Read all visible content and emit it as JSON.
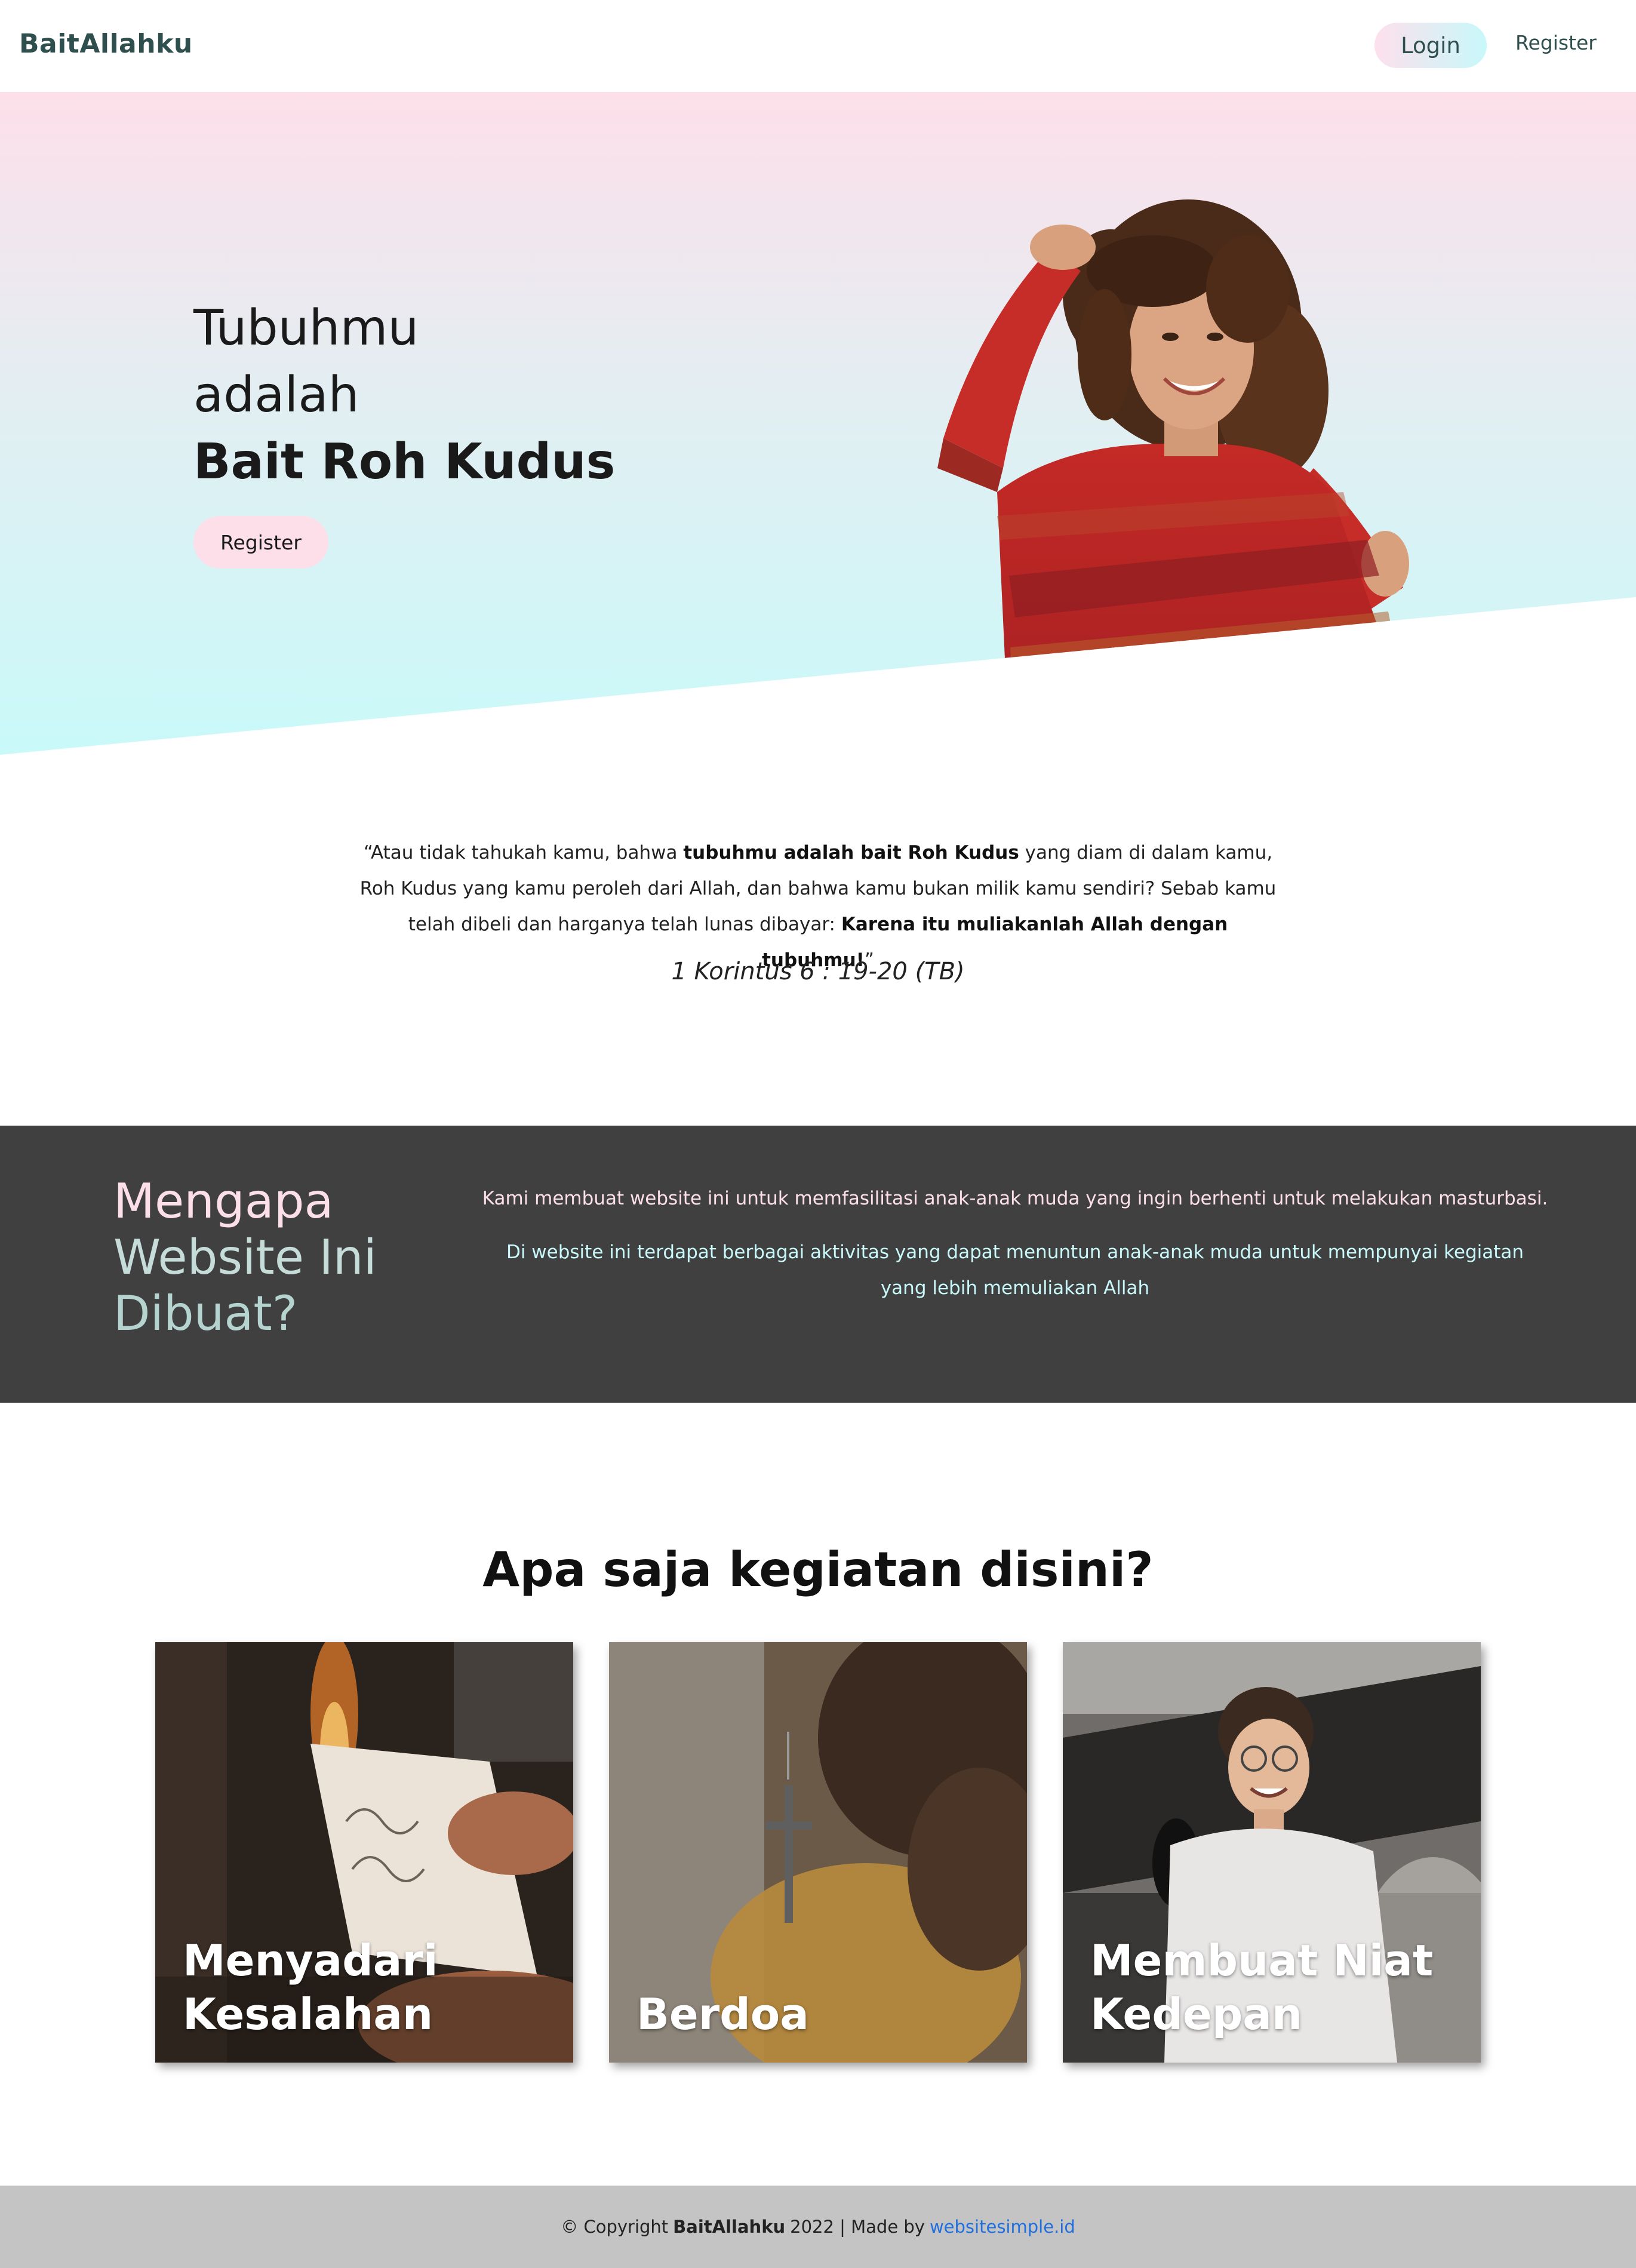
{
  "nav": {
    "brand": "BaitAllahku",
    "login_label": "Login",
    "register_label": "Register"
  },
  "hero": {
    "title_line1": "Tubuhmu",
    "title_line2": "adalah",
    "title_line3": "Bait Roh Kudus",
    "register_label": "Register"
  },
  "quote": {
    "part1": "“Atau tidak tahukah kamu, bahwa ",
    "bold1": "tubuhmu adalah bait Roh Kudus",
    "part2": " yang diam di dalam kamu, Roh Kudus yang kamu peroleh dari Allah, dan bahwa kamu bukan milik kamu sendiri? Sebab kamu telah dibeli dan harganya telah lunas dibayar: ",
    "bold2": "Karena itu muliakanlah Allah dengan tubuhmu!",
    "part3": "”",
    "reference": "1 Korintus 6 : 19-20 (TB)"
  },
  "why": {
    "title_line1": "Mengapa",
    "title_line2": "Website Ini",
    "title_line3": "Dibuat?",
    "paragraph1": "Kami membuat website ini untuk memfasilitasi anak-anak muda yang ingin berhenti untuk melakukan masturbasi.",
    "paragraph2": "Di website ini terdapat berbagai aktivitas yang dapat menuntun anak-anak muda untuk mempunyai kegiatan yang lebih memuliakan Allah"
  },
  "activities": {
    "title": "Apa saja kegiatan disini?",
    "cards": [
      {
        "label": "Menyadari Kesalahan"
      },
      {
        "label": "Berdoa"
      },
      {
        "label": "Membuat Niat Kedepan"
      }
    ]
  },
  "footer": {
    "copyright": "© Copyright",
    "brand": "BaitAllahku",
    "year_text": "2022 | Made by",
    "link_text": "websitesimple.id"
  },
  "colors": {
    "pink": "#fddfea",
    "cyan": "#c8f8fa",
    "dark_section": "#404040",
    "footer_bg": "#c4c4c4",
    "link": "#1f6fe0"
  }
}
